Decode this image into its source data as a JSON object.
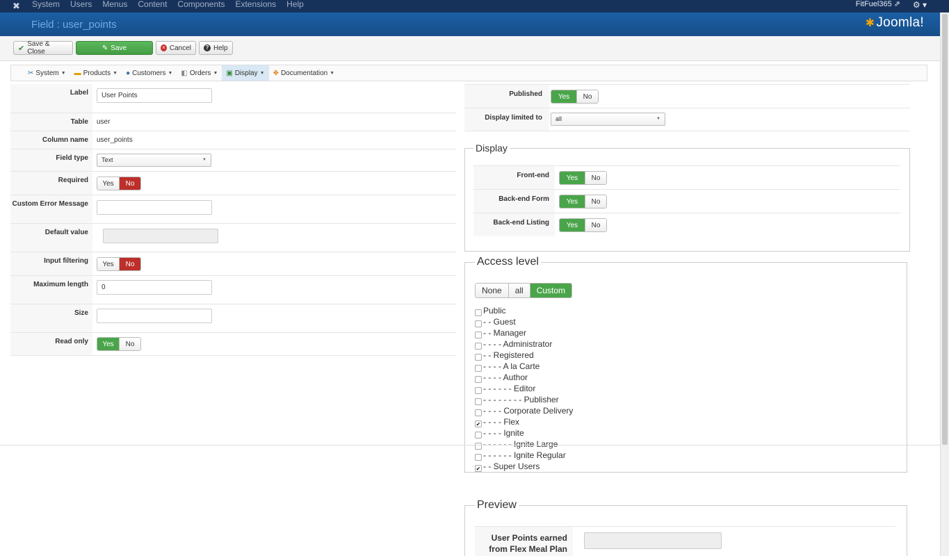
{
  "topbar": {
    "menu": [
      "System",
      "Users",
      "Menus",
      "Content",
      "Components",
      "Extensions",
      "Help"
    ],
    "site_name": "FitFuel365",
    "external_icon": "external-link-icon",
    "settings_icon": "gear-icon"
  },
  "header": {
    "title": "Field : user_points",
    "brand": "Joomla!"
  },
  "toolbar": {
    "save_close": "Save & Close",
    "save": "Save",
    "cancel": "Cancel",
    "help": "Help"
  },
  "submenu": {
    "items": [
      "System",
      "Products",
      "Customers",
      "Orders",
      "Display",
      "Documentation"
    ],
    "active": "Display"
  },
  "left_form": {
    "label_label": "Label",
    "label_value": "User Points",
    "table_label": "Table",
    "table_value": "user",
    "column_label": "Column name",
    "column_value": "user_points",
    "fieldtype_label": "Field type",
    "fieldtype_value": "Text",
    "required_label": "Required",
    "custom_error_label": "Custom Error Message",
    "custom_error_value": "",
    "default_label": "Default value",
    "default_value": "",
    "input_filtering_label": "Input filtering",
    "maxlen_label": "Maximum length",
    "maxlen_value": "0",
    "size_label": "Size",
    "size_value": "",
    "readonly_label": "Read only",
    "yes": "Yes",
    "no": "No"
  },
  "right_form": {
    "published_label": "Published",
    "display_limited_label": "Display limited to",
    "display_limited_value": "all",
    "yes": "Yes",
    "no": "No"
  },
  "display_fieldset": {
    "legend": "Display",
    "frontend_label": "Front-end",
    "backend_form_label": "Back-end Form",
    "backend_listing_label": "Back-end Listing"
  },
  "access": {
    "legend": "Access level",
    "buttons": [
      "None",
      "all",
      "Custom"
    ],
    "active": "Custom",
    "groups": [
      {
        "label": "Public",
        "checked": false
      },
      {
        "label": "- - Guest",
        "checked": false
      },
      {
        "label": "- - Manager",
        "checked": false
      },
      {
        "label": "- - - - Administrator",
        "checked": false
      },
      {
        "label": "- - Registered",
        "checked": false
      },
      {
        "label": "- - - - A la Carte",
        "checked": false
      },
      {
        "label": "- - - - Author",
        "checked": false
      },
      {
        "label": "- - - - - - Editor",
        "checked": false
      },
      {
        "label": "- - - - - - - - Publisher",
        "checked": false
      },
      {
        "label": "- - - - Corporate Delivery",
        "checked": false
      },
      {
        "label": "- - - - Flex",
        "checked": true
      },
      {
        "label": "- - - - Ignite",
        "checked": false
      },
      {
        "label": "- - - - - - Ignite Large",
        "checked": false
      },
      {
        "label": "- - - - - - Ignite Regular",
        "checked": false
      },
      {
        "label": "- - Super Users",
        "checked": true
      }
    ]
  },
  "preview": {
    "legend": "Preview",
    "field_label": "User Points earned from Flex Meal Plan",
    "field_value": ""
  },
  "colors": {
    "green": "#4aa54a",
    "red": "#bd2f2b",
    "header_blue": "#1b5fa4"
  }
}
